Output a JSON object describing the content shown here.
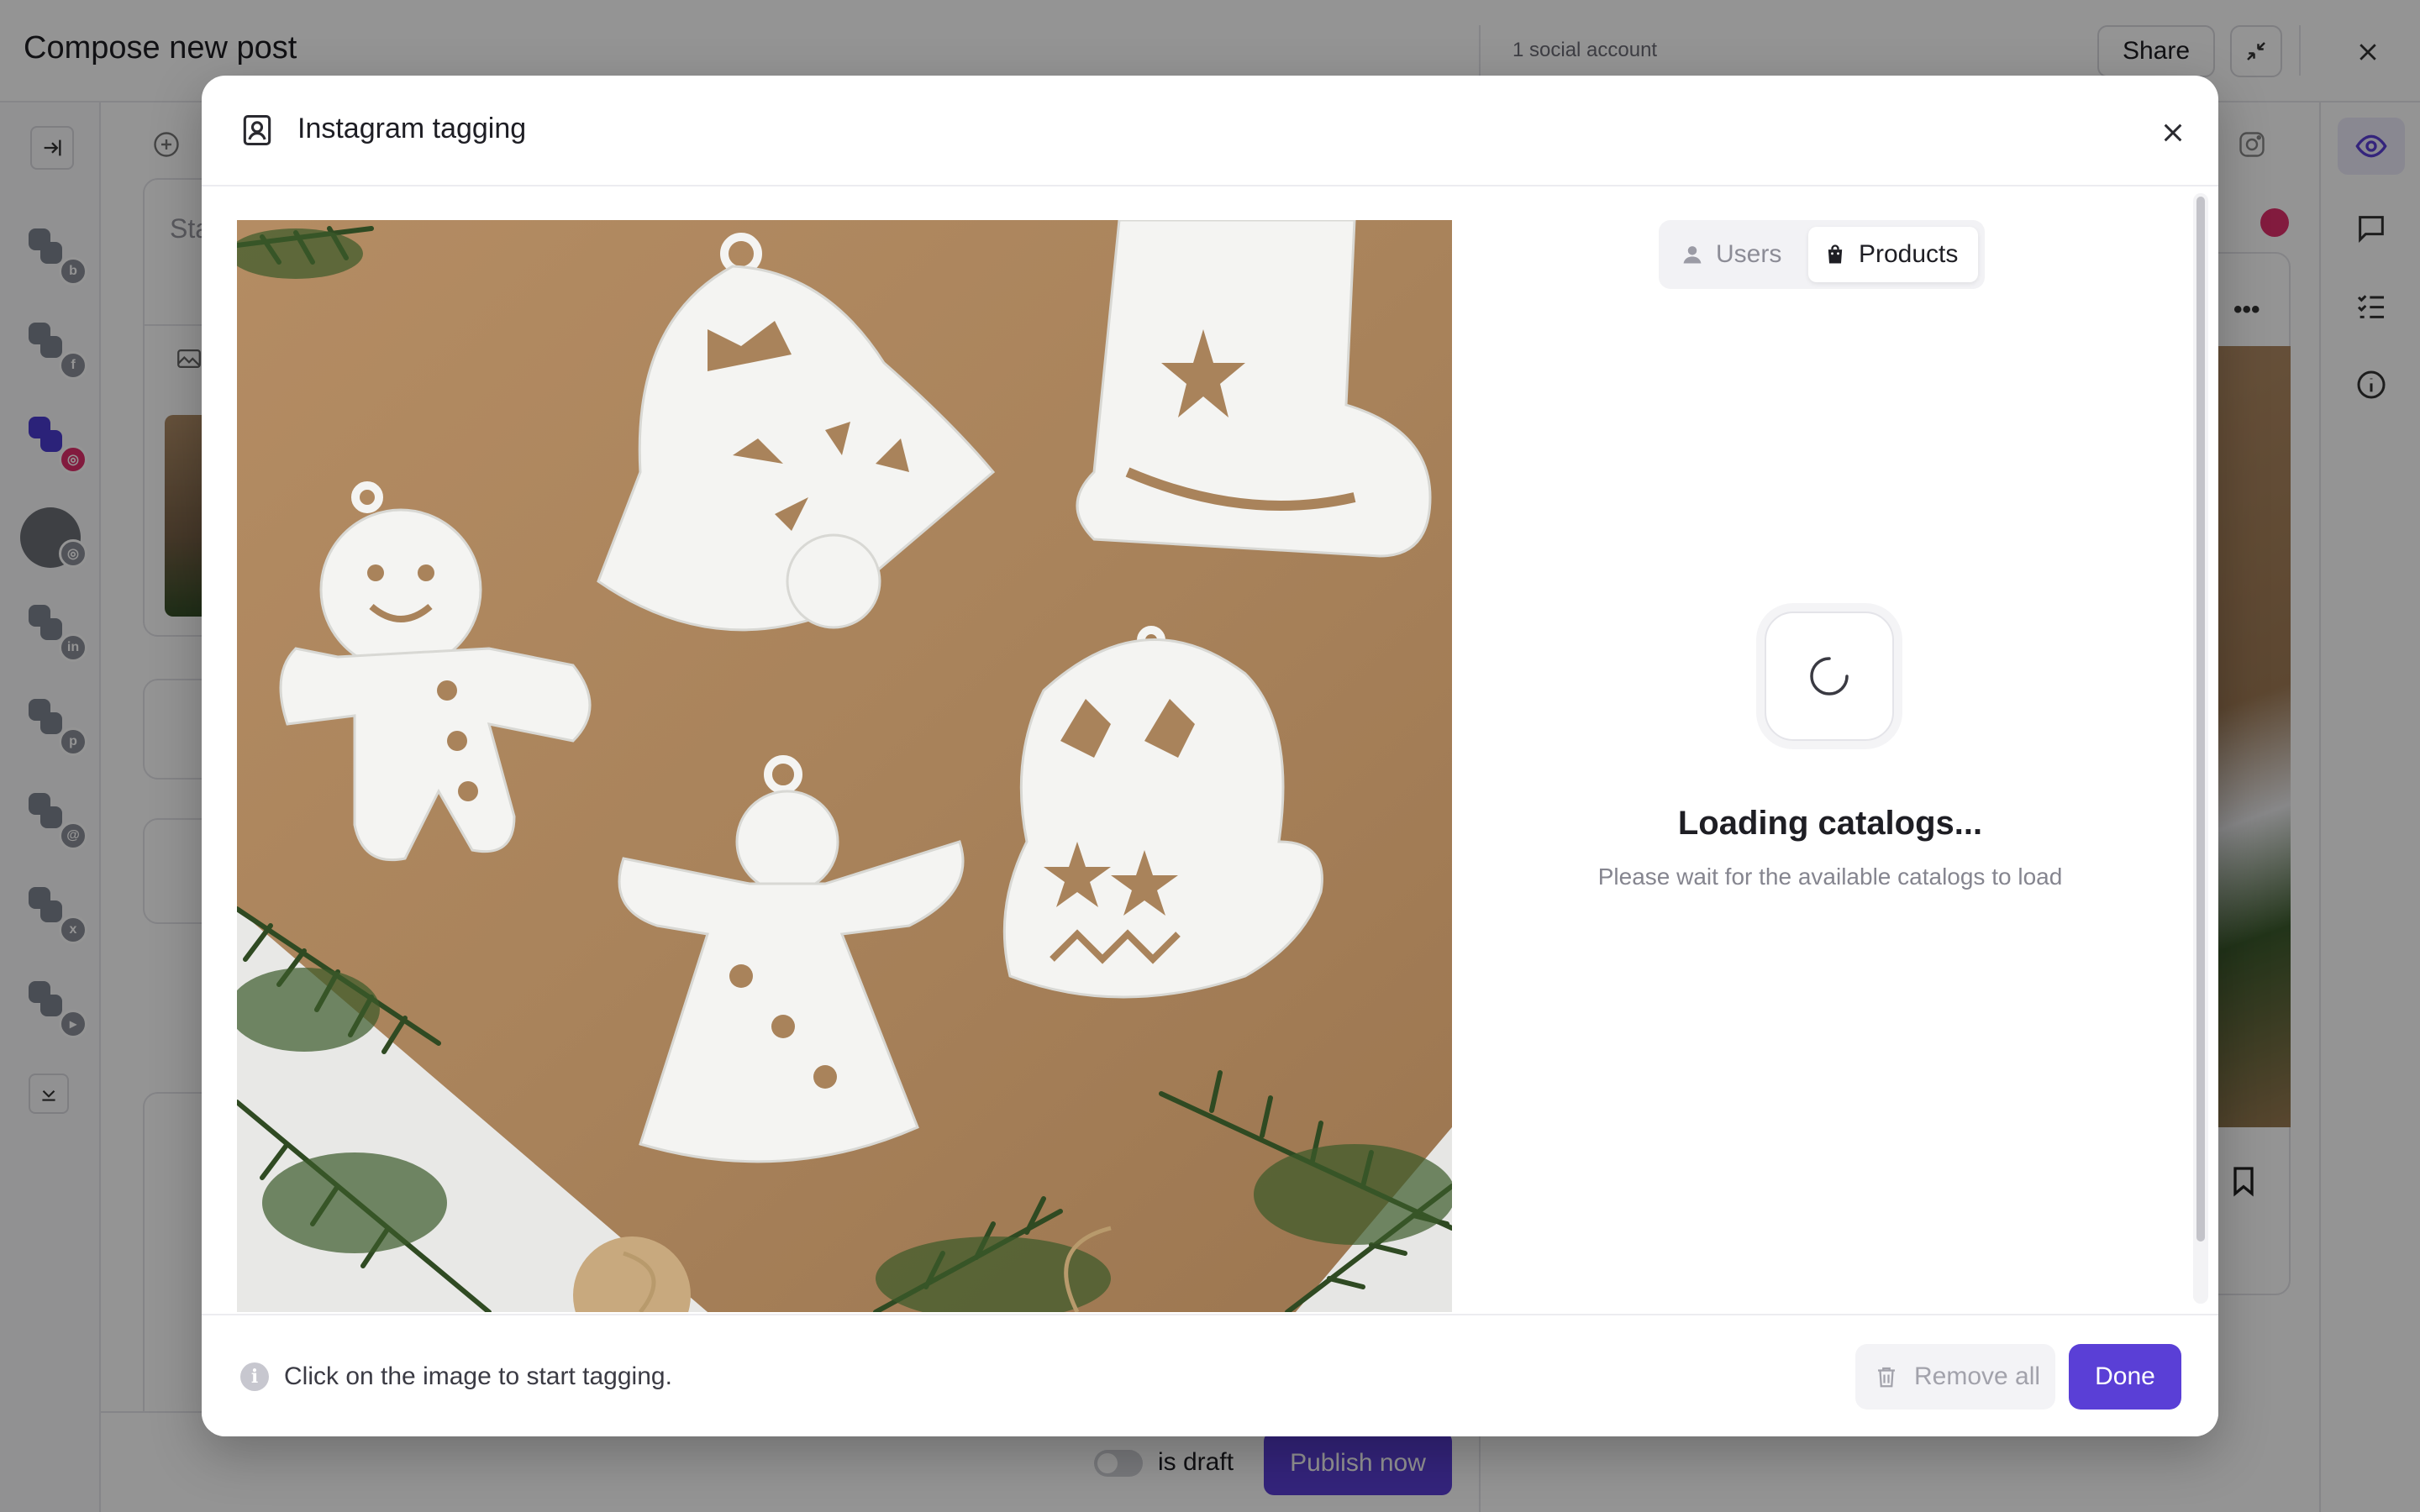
{
  "app": {
    "title": "Compose new post",
    "accounts_count": "1 social account",
    "share_label": "Share",
    "editor_placeholder_fragment": "Sta",
    "draft_label": "is draft",
    "publish_label": "Publish now"
  },
  "left_rail": {
    "accounts": [
      {
        "network": "bluesky",
        "icon": "butterfly-icon"
      },
      {
        "network": "facebook",
        "icon": "facebook-icon"
      },
      {
        "network": "instagram",
        "icon": "instagram-icon",
        "selected": true
      },
      {
        "network": "instagram-avatar",
        "icon": "instagram-icon"
      },
      {
        "network": "linkedin",
        "icon": "linkedin-icon"
      },
      {
        "network": "pinterest",
        "icon": "pinterest-icon"
      },
      {
        "network": "threads",
        "icon": "threads-icon"
      },
      {
        "network": "x",
        "icon": "x-icon"
      },
      {
        "network": "youtube",
        "icon": "youtube-icon"
      }
    ]
  },
  "right_rail": {
    "icons": [
      "eye-icon",
      "comment-icon",
      "checklist-icon",
      "info-icon"
    ]
  },
  "modal": {
    "title": "Instagram tagging",
    "tabs": [
      {
        "label": "Users",
        "icon": "user-icon",
        "active": false
      },
      {
        "label": "Products",
        "icon": "shopping-bag-icon",
        "active": true
      }
    ],
    "loading": {
      "title": "Loading catalogs...",
      "subtitle": "Please wait for the available catalogs to load"
    },
    "footer": {
      "hint": "Click on the image to start tagging.",
      "remove_all_label": "Remove all",
      "done_label": "Done"
    }
  },
  "colors": {
    "accent": "#5a3fd6",
    "instagram": "#e1306c",
    "overlay": "rgba(0,0,0,0.42)"
  }
}
